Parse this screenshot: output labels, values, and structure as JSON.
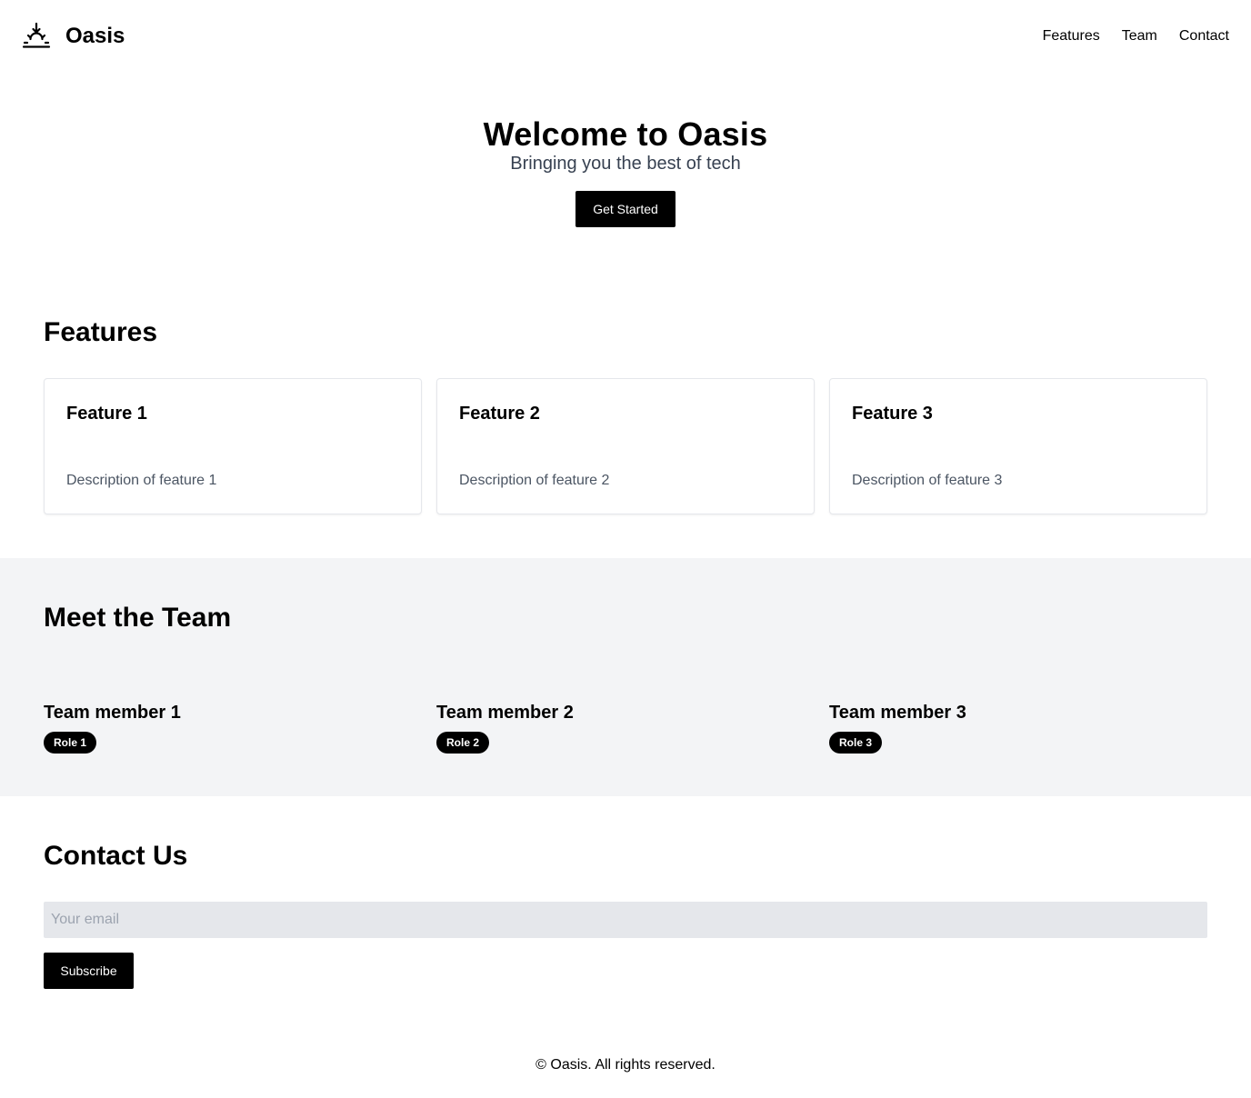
{
  "header": {
    "brand": "Oasis",
    "logo_icon": "sunrise-icon",
    "nav": [
      "Features",
      "Team",
      "Contact"
    ]
  },
  "hero": {
    "title": "Welcome to Oasis",
    "subtitle": "Bringing you the best of tech",
    "cta_label": "Get Started"
  },
  "features": {
    "title": "Features",
    "items": [
      {
        "title": "Feature 1",
        "description": "Description of feature 1"
      },
      {
        "title": "Feature 2",
        "description": "Description of feature 2"
      },
      {
        "title": "Feature 3",
        "description": "Description of feature 3"
      }
    ]
  },
  "team": {
    "title": "Meet the Team",
    "members": [
      {
        "name": "Team member 1",
        "role": "Role 1"
      },
      {
        "name": "Team member 2",
        "role": "Role 2"
      },
      {
        "name": "Team member 3",
        "role": "Role 3"
      }
    ]
  },
  "contact": {
    "title": "Contact Us",
    "email_placeholder": "Your email",
    "email_value": "",
    "subscribe_label": "Subscribe"
  },
  "footer": {
    "text": "© Oasis. All rights reserved."
  },
  "colors": {
    "accent": "#000000",
    "team_background": "#f3f4f6",
    "input_background": "#e5e7eb",
    "muted_text": "#4b5563"
  }
}
